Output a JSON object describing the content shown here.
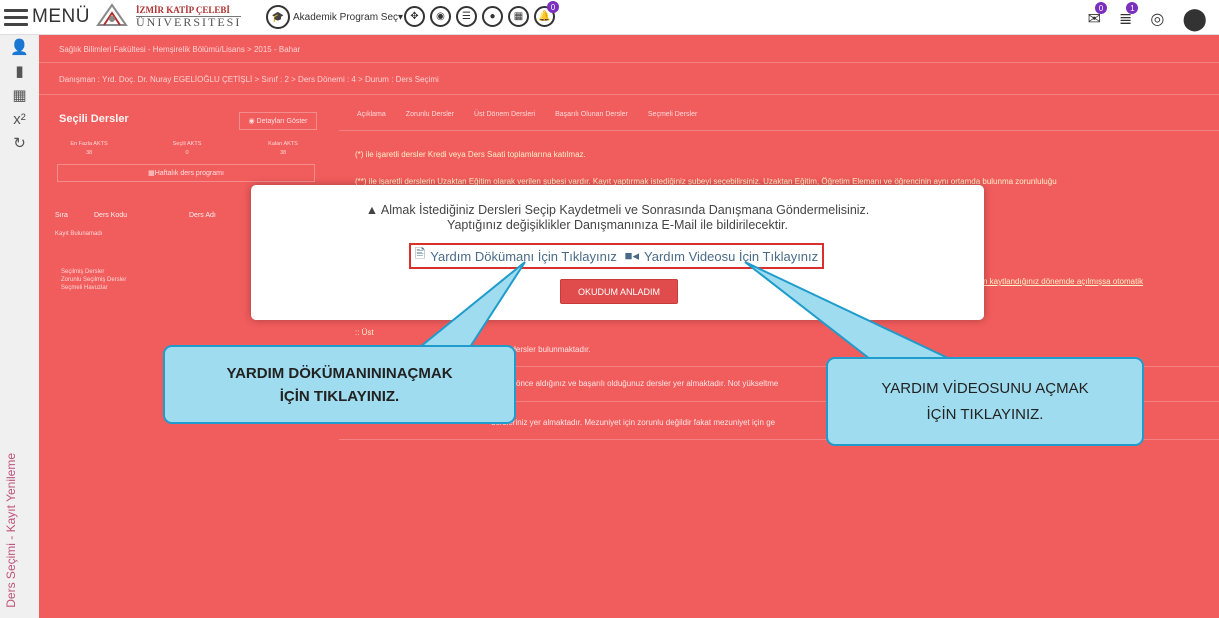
{
  "topbar": {
    "menu_label": "MENÜ",
    "logo_line1": "İZMİR KATİP ÇELEBİ",
    "logo_line2": "ÜNIVERSITESI",
    "program_select": "Akademik Program Seç",
    "tool_badge": "0",
    "mail_badge": "0",
    "list_badge": "1"
  },
  "sidebar": {
    "vertical_label": "Ders Seçimi - Kayıt Yenileme"
  },
  "main": {
    "breadcrumb": "Sağlık Bilimleri Fakültesi - Hemşirelik Bölümü/Lisans  >  2015 - Bahar",
    "advisor_line": "Danışman : Yrd. Doç. Dr. Nuray EGELİOĞLU ÇETİŞLİ  >  Sınıf : 2  >  Ders Dönemi : 4  >  Durum : Ders Seçimi",
    "selected_title": "Seçili Dersler",
    "detail_button": "Detayları Göster",
    "ects": [
      {
        "label": "En Fazla AKTS",
        "value": "38"
      },
      {
        "label": "Seçili AKTS",
        "value": "0"
      },
      {
        "label": "Kalan AKTS",
        "value": "38"
      }
    ],
    "weekly_button": "Haftalık ders programı",
    "table_headers": [
      "Sıra",
      "Ders Kodu",
      "Ders Adı"
    ],
    "no_record": "Kayıt Bulunamadı",
    "legend": [
      "Seçilmiş Dersler",
      "Zorunlu Seçilmiş Dersler",
      "Seçmeli Havuzlar"
    ],
    "tabs": [
      "Açıklama",
      "Zorunlu Dersler",
      "Üst Dönem Dersleri",
      "Başarılı Olunan Dersler",
      "Seçmeli Dersler"
    ],
    "desc1": "(*) ile işaretli dersler Kredi veya Ders Saati toplamlarına katılmaz.",
    "desc2": "(**) ile işaretli derslerin Uzaktan Eğitim olarak verilen şubesi vardır. Kayıt yaptırmak istediğiniz şubeyi seçebilirsiniz. Uzaktan Eğitim, Öğretim Elemanı ve öğrencinin aynı ortamda bulunma zorunluluğu",
    "desc3": "n kaytlandığınız dönemde açılmışsa otomatik",
    "desc4": "::  Üst",
    "desc5": "eminize ait dersler bulunmaktadır.",
    "desc6": "daha önce aldığınız ve başarılı olduğunuz dersler yer almaktadır. Not yükseltme",
    "desc7": "dersleriniz yer almaktadır. Mezuniyet için zorunlu değildir fakat mezuniyet için ge"
  },
  "modal": {
    "line1": "Almak İstediğiniz Dersleri Seçip Kaydetmeli ve Sonrasında Danışmana Göndermelisiniz.",
    "line2": "Yaptığınız değişiklikler Danışmanınıza E-Mail ile bildirilecektir.",
    "doc_link": "Yardım Dökümanı İçin Tıklayınız",
    "video_link": "Yardım Videosu İçin Tıklayınız",
    "ok_button": "OKUDUM ANLADIM"
  },
  "callouts": {
    "left_line1": "YARDIM DÖKÜMANININAÇMAK",
    "left_line2": "İÇİN TIKLAYINIZ.",
    "right_line1": "YARDIM VİDEOSUNU AÇMAK",
    "right_line2": "İÇİN TIKLAYINIZ."
  },
  "colors": {
    "main_bg": "#f15c5c",
    "callout_fill": "#9fdcef",
    "callout_border": "#1f9ccc",
    "highlight_border": "#d9302c",
    "badge": "#7b2fbe"
  }
}
